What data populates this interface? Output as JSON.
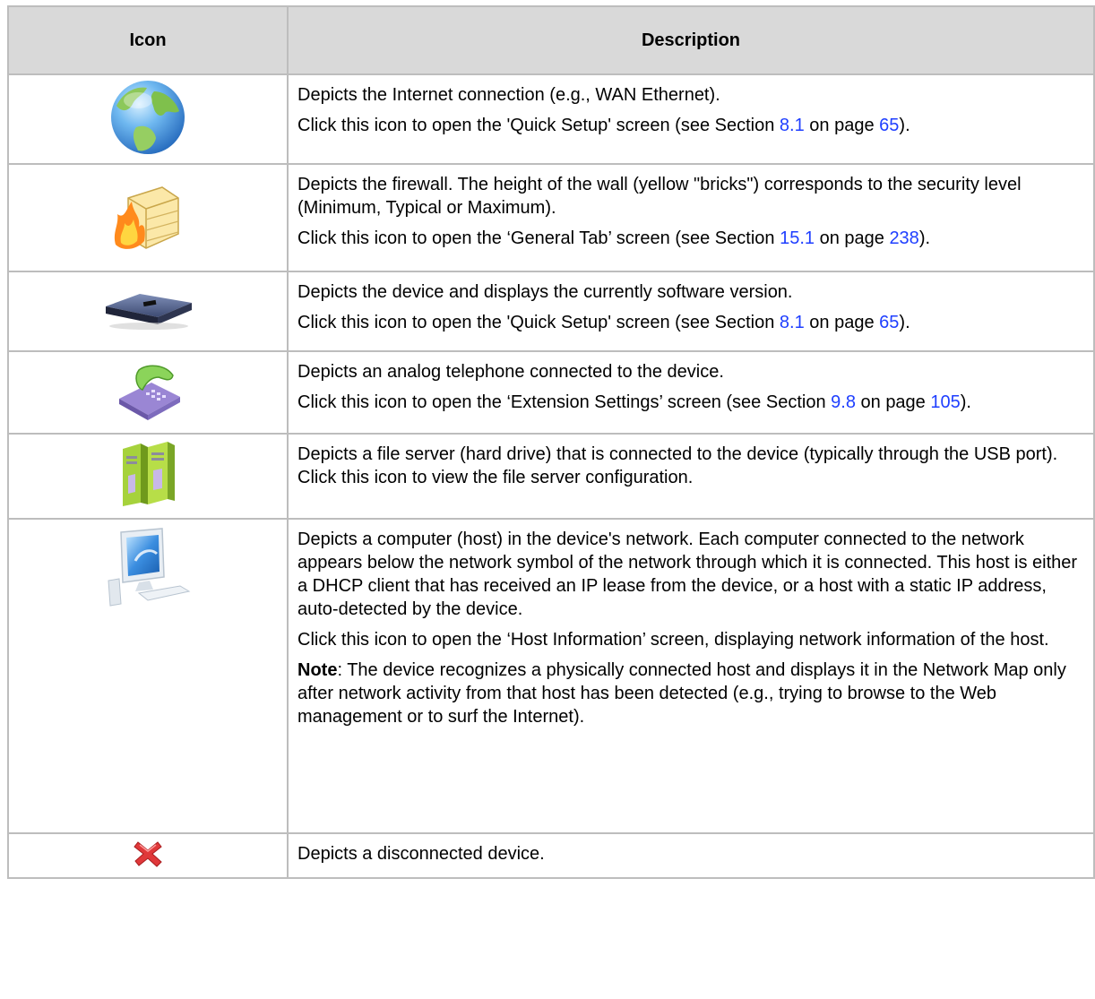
{
  "table": {
    "headers": {
      "icon": "Icon",
      "description": "Description"
    },
    "rows": [
      {
        "icon": "internet-globe-icon",
        "p1": "Depicts the Internet connection (e.g., WAN Ethernet).",
        "p2": {
          "pre": "Click this icon to open the 'Quick Setup' screen (see Section ",
          "section": "8.1",
          "mid": " on page ",
          "page": "65",
          "post": ")."
        }
      },
      {
        "icon": "firewall-icon",
        "p1": "Depicts the firewall. The height of the wall (yellow \"bricks\") corresponds to the security level (Minimum, Typical or Maximum).",
        "p2": {
          "pre": "Click this icon to open the ‘General Tab’ screen (see Section ",
          "section": "15.1",
          "mid": " on page ",
          "page": "238",
          "post": ")."
        }
      },
      {
        "icon": "device-router-icon",
        "p1": "Depicts the device and displays the currently software version.",
        "p2": {
          "pre": "Click this icon to open the 'Quick Setup' screen (see Section ",
          "section": "8.1",
          "mid": " on page ",
          "page": "65",
          "post": ")."
        }
      },
      {
        "icon": "analog-telephone-icon",
        "p1": "Depicts an analog telephone connected to the device.",
        "p2": {
          "pre": "Click this icon to open the ‘Extension Settings’ screen (see Section ",
          "section": "9.8",
          "mid": " on page ",
          "page": "105",
          "post": ")."
        }
      },
      {
        "icon": "file-server-icon",
        "p1": "Depicts a file server (hard drive) that is connected to the device (typically through the USB port). Click this icon to view the file server configuration."
      },
      {
        "icon": "computer-host-icon",
        "p1": "Depicts a computer (host) in the device's network. Each computer connected to the network appears below the network symbol of the network through which it is connected. This host is either a DHCP client that has received an IP lease from the device, or a host with a static IP address, auto-detected by the device.",
        "p2_text": "Click this icon to open the ‘Host Information’ screen, displaying network information of the host.",
        "note_label": "Note",
        "note_text": ": The device recognizes a physically connected host and displays it in the Network Map only after network activity from that host has been detected (e.g., trying to browse to the Web management or to surf the Internet)."
      },
      {
        "icon": "disconnected-x-icon",
        "p1": "Depicts a disconnected device."
      }
    ]
  }
}
